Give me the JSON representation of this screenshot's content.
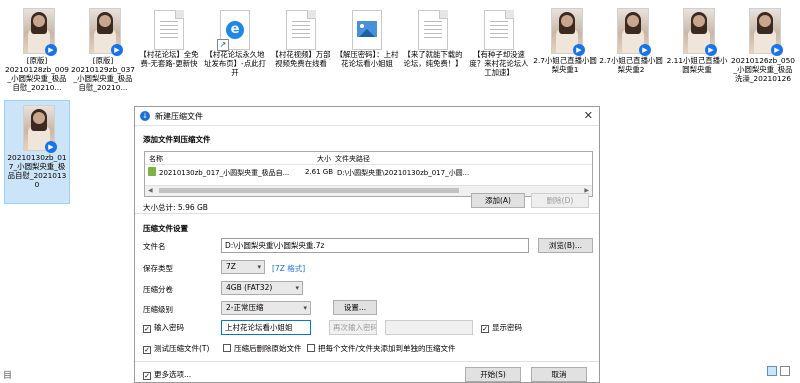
{
  "explorer": {
    "files": [
      {
        "type": "video",
        "label": "20210128zb_009_小圆梨央重_极品自慰_20210..."
      },
      {
        "type": "video",
        "label": "[原版]\n20210129zb_037_小圆梨央重_极品自慰_20210..."
      },
      {
        "type": "text",
        "label": "【村花论坛】全免费-无套路-更新快"
      },
      {
        "type": "url",
        "label": "【村花论坛永久地址发布页】-点此打开"
      },
      {
        "type": "text",
        "label": "【村花视频】万部视频免费在线看"
      },
      {
        "type": "image",
        "label": "【解压密码】：上村花论坛看小姐姐"
      },
      {
        "type": "text",
        "label": "【来了就能下载的论坛，纯免费！】"
      },
      {
        "type": "text",
        "label": "【有种子却没速度？来村花论坛人工加速】"
      },
      {
        "type": "video",
        "label": "2.7小姐己直播小圆梨央重1"
      },
      {
        "type": "video",
        "label": "2.7小姐己直播小圆梨央重2"
      },
      {
        "type": "video",
        "label": "2.11小姐己直播小圆梨央重"
      },
      {
        "type": "video",
        "label": "20210126zb_050_小圆梨央重_极品洗澡_20210126"
      },
      {
        "type": "video",
        "label": "20210130zb_017_小圆梨央重_极品自慰_20210130"
      }
    ],
    "first_label_prefix": "[原版]",
    "status_text": "目"
  },
  "dialog": {
    "title": "新建压缩文件",
    "add_section_title": "添加文件到压缩文件",
    "list": {
      "col_name": "名称",
      "col_size": "大小",
      "col_path": "文件夹路径",
      "rows": [
        {
          "name": "20210130zb_017_小圆梨央重_极品自...",
          "size": "2.61 GB",
          "path": "D:\\小圆梨央重\\20210130zb_017_小圆..."
        }
      ]
    },
    "total_size": "大小总计: 5.96 GB",
    "add_button": "添加(A)",
    "delete_button": "删除(D)",
    "settings_title": "压缩文件设置",
    "filename_label": "文件名",
    "filename_value": "D:\\小圆梨央重\\小圆梨央重.7z",
    "browse_button": "浏览(B)...",
    "format_label": "保存类型",
    "format_value": "7Z",
    "format_link": "[7Z 格式]",
    "volume_label": "压缩分卷",
    "volume_value": "4GB (FAT32)",
    "level_label": "压缩级别",
    "level_value": "2-正常压缩",
    "settings_button": "设置...",
    "password_check_label": "输入密码",
    "password_value": "上村花论坛看小姐姐",
    "password_repeat_placeholder": "再次输入密码",
    "show_password_label": "显示密码",
    "test_label": "测试压缩文件(T)",
    "delete_after_label": "压缩后删除原始文件",
    "separate_label": "把每个文件/文件夹添加到单独的压缩文件",
    "more_options_label": "更多选项...",
    "start_button": "开始(S)",
    "cancel_button": "取消"
  }
}
